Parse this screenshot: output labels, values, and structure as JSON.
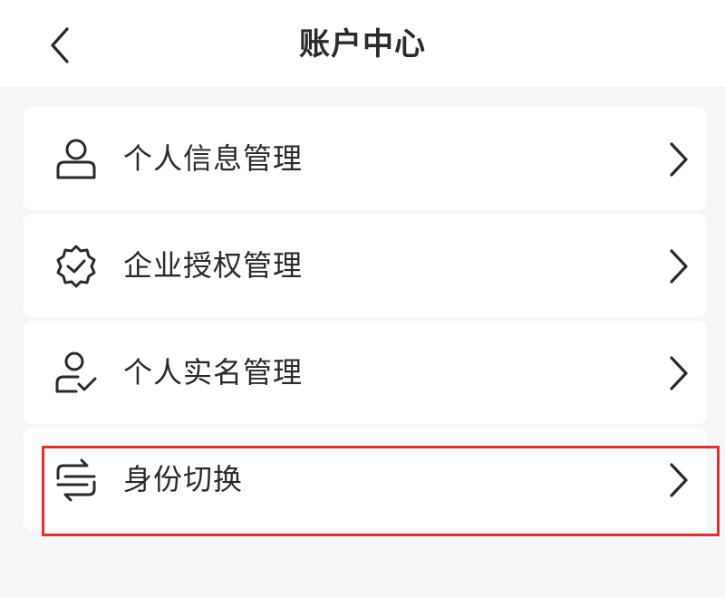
{
  "header": {
    "title": "账户中心",
    "back_icon": "chevron-left-icon"
  },
  "menu": {
    "items": [
      {
        "label": "个人信息管理",
        "icon": "user-icon"
      },
      {
        "label": "企业授权管理",
        "icon": "badge-check-icon"
      },
      {
        "label": "个人实名管理",
        "icon": "user-check-icon"
      },
      {
        "label": "身份切换",
        "icon": "switch-arrows-icon"
      }
    ],
    "highlighted_item_index": 3,
    "highlight_color": "#e2302c"
  },
  "colors": {
    "background": "#f5f6f8",
    "card": "#ffffff",
    "text": "#2a2a2a"
  }
}
